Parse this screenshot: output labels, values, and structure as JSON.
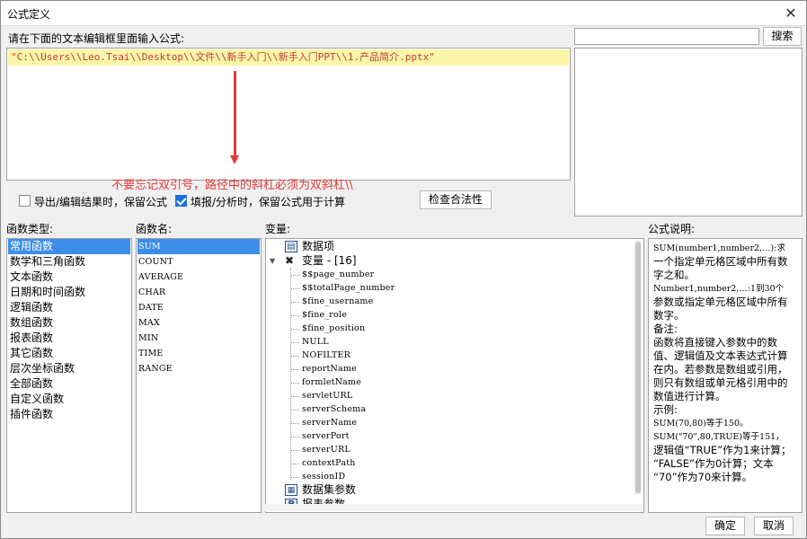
{
  "window": {
    "title": "公式定义"
  },
  "editor": {
    "prompt": "请在下面的文本编辑框里面输入公式:",
    "formula": "\"C:\\\\Users\\\\Leo.Tsai\\\\Desktop\\\\文件\\\\新手入门\\\\新手入门PPT\\\\1.产品简介.pptx\""
  },
  "annotation": {
    "text": "不要忘记双引号，路径中的斜杠必须为双斜杠\\\\",
    "color": "#e03a3a"
  },
  "search": {
    "placeholder": "",
    "button_label": "搜索"
  },
  "options": {
    "export_keep_formula": {
      "label": "导出/编辑结果时，保留公式",
      "checked": false
    },
    "fill_keep_formula": {
      "label": "填报/分析时，保留公式用于计算",
      "checked": true
    },
    "check_button": "检查合法性"
  },
  "function_types": {
    "header": "函数类型:",
    "items": [
      "常用函数",
      "数学和三角函数",
      "文本函数",
      "日期和时间函数",
      "逻辑函数",
      "数组函数",
      "报表函数",
      "其它函数",
      "层次坐标函数",
      "全部函数",
      "自定义函数",
      "插件函数"
    ],
    "selected_index": 0
  },
  "function_names": {
    "header": "函数名:",
    "items": [
      "SUM",
      "COUNT",
      "AVERAGE",
      "CHAR",
      "DATE",
      "MAX",
      "MIN",
      "TIME",
      "RANGE"
    ],
    "selected_index": 0
  },
  "variables": {
    "header": "变量:",
    "dataset_item": "数据项",
    "var_group": "变量 - [16]",
    "var_items": [
      "$$page_number",
      "$$totalPage_number",
      "$fine_username",
      "$fine_role",
      "$fine_position",
      "NULL",
      "NOFILTER",
      "reportName",
      "formletName",
      "servletURL",
      "serverSchema",
      "serverName",
      "serverPort",
      "serverURL",
      "contextPath",
      "sessionID"
    ],
    "dataset_params": "数据集参数",
    "report_params": "报表参数"
  },
  "description": {
    "header": "公式说明:",
    "lines": [
      {
        "text": "SUM(number1,number2,…):求",
        "serif": true
      },
      {
        "text": "一个指定单元格区域中所有数",
        "serif": false
      },
      {
        "text": "字之和。",
        "serif": false
      },
      {
        "text": "Number1,number2,…:1到30个",
        "serif": true
      },
      {
        "text": "参数或指定单元格区域中所有",
        "serif": false
      },
      {
        "text": "数字。",
        "serif": false
      },
      {
        "text": "备注:",
        "serif": false
      },
      {
        "text": "函数将直接键入参数中的数",
        "serif": false
      },
      {
        "text": "值、逻辑值及文本表达式计算",
        "serif": false
      },
      {
        "text": "在内。若参数是数组或引用，",
        "serif": false
      },
      {
        "text": "则只有数组或单元格引用中的",
        "serif": false
      },
      {
        "text": "数值进行计算。",
        "serif": false
      },
      {
        "text": "示例:",
        "serif": false
      },
      {
        "text": "SUM(70,80)等于150。",
        "serif": true
      },
      {
        "text": "SUM(\"70\",80,TRUE)等于151，",
        "serif": true
      },
      {
        "text": "逻辑值“TRUE”作为1来计算；",
        "serif": false
      },
      {
        "text": "“FALSE”作为0计算；文本",
        "serif": false
      },
      {
        "text": "“70”作为70来计算。",
        "serif": false
      }
    ]
  },
  "footer": {
    "ok": "确定",
    "cancel": "取消"
  },
  "colors": {
    "selection": "#3d8ee8",
    "formula_bg": "#fbf6a8",
    "formula_text": "#c43b3b",
    "accent_check": "#1e6fd9"
  }
}
